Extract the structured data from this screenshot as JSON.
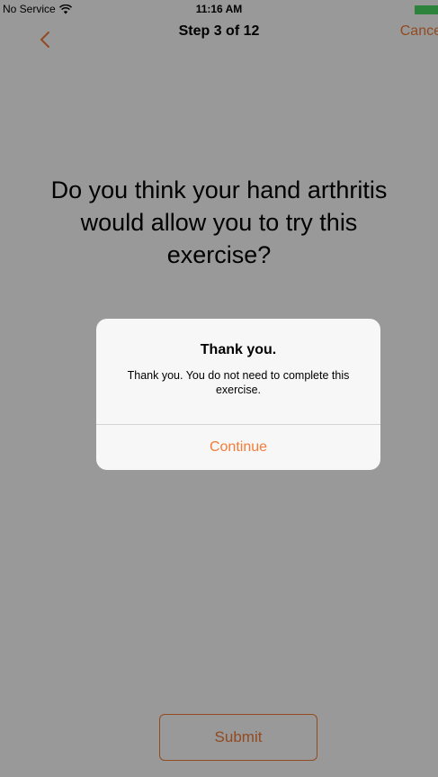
{
  "status_bar": {
    "carrier": "No Service",
    "time": "11:16 AM",
    "battery_color": "#4cd964"
  },
  "nav": {
    "back_icon": "chevron-left-icon",
    "title": "Step 3 of 12",
    "cancel_label": "Cance"
  },
  "question": {
    "text": "Do you think your hand arthritis would allow you to try this exercise?"
  },
  "submit": {
    "label": "Submit"
  },
  "alert": {
    "title": "Thank you.",
    "message": "Thank you. You do not need to complete this exercise.",
    "continue_label": "Continue"
  },
  "colors": {
    "accent": "#f47c38",
    "overlay": "rgba(0,0,0,0.4)"
  }
}
